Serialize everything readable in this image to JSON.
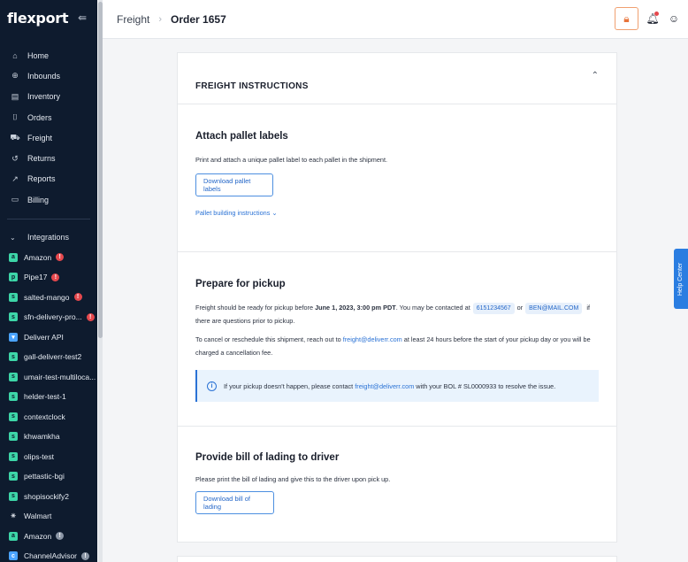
{
  "sidebar": {
    "logo": "flexport",
    "nav": [
      {
        "label": "Home",
        "icon": "home-icon",
        "glyph": "⌂"
      },
      {
        "label": "Inbounds",
        "icon": "inbounds-icon",
        "glyph": "⊕"
      },
      {
        "label": "Inventory",
        "icon": "inventory-icon",
        "glyph": "▤"
      },
      {
        "label": "Orders",
        "icon": "orders-icon",
        "glyph": "⌷"
      },
      {
        "label": "Freight",
        "icon": "freight-icon",
        "glyph": "⛟"
      },
      {
        "label": "Returns",
        "icon": "returns-icon",
        "glyph": "↺"
      },
      {
        "label": "Reports",
        "icon": "reports-icon",
        "glyph": "↗"
      },
      {
        "label": "Billing",
        "icon": "billing-icon",
        "glyph": "▭"
      }
    ],
    "integrations_label": "Integrations",
    "integrations": [
      {
        "label": "Amazon",
        "store": "amazon",
        "color": "#3dd6a8",
        "glyph": "a",
        "badge": "!",
        "badge_type": "red"
      },
      {
        "label": "Pipe17",
        "store": "pipe17",
        "color": "#3dd6a8",
        "glyph": "p",
        "badge": "!",
        "badge_type": "red"
      },
      {
        "label": "salted-mango",
        "store": "shopify",
        "color": "#3dd6a8",
        "glyph": "s",
        "badge": "!",
        "badge_type": "red"
      },
      {
        "label": "sfn-delivery-pro...",
        "store": "shopify",
        "color": "#3dd6a8",
        "glyph": "s",
        "badge": "!",
        "badge_type": "red"
      },
      {
        "label": "Deliverr API",
        "store": "deliverr",
        "color": "#4aa3ff",
        "glyph": "▾",
        "badge": "",
        "badge_type": ""
      },
      {
        "label": "gall-deliverr-test2",
        "store": "shopify",
        "color": "#3dd6a8",
        "glyph": "s",
        "badge": "",
        "badge_type": ""
      },
      {
        "label": "umair-test-multiloca...",
        "store": "shopify",
        "color": "#3dd6a8",
        "glyph": "s",
        "badge": "",
        "badge_type": ""
      },
      {
        "label": "helder-test-1",
        "store": "shopify",
        "color": "#3dd6a8",
        "glyph": "s",
        "badge": "",
        "badge_type": ""
      },
      {
        "label": "contextclock",
        "store": "shopify",
        "color": "#3dd6a8",
        "glyph": "s",
        "badge": "",
        "badge_type": ""
      },
      {
        "label": "khwamkha",
        "store": "shopify",
        "color": "#3dd6a8",
        "glyph": "s",
        "badge": "",
        "badge_type": ""
      },
      {
        "label": "olips-test",
        "store": "shopify",
        "color": "#3dd6a8",
        "glyph": "s",
        "badge": "",
        "badge_type": ""
      },
      {
        "label": "pettastic-bgi",
        "store": "shopify",
        "color": "#3dd6a8",
        "glyph": "s",
        "badge": "",
        "badge_type": ""
      },
      {
        "label": "shopisockify2",
        "store": "shopify",
        "color": "#3dd6a8",
        "glyph": "s",
        "badge": "",
        "badge_type": ""
      },
      {
        "label": "Walmart",
        "store": "walmart",
        "color": "#0e1b2e",
        "glyph": "✳",
        "badge": "",
        "badge_type": ""
      },
      {
        "label": "Amazon",
        "store": "amazon",
        "color": "#3dd6a8",
        "glyph": "a",
        "badge": "!",
        "badge_type": "grey"
      },
      {
        "label": "ChannelAdvisor",
        "store": "channeladvisor",
        "color": "#4aa3ff",
        "glyph": "c",
        "badge": "!",
        "badge_type": "grey"
      }
    ]
  },
  "header": {
    "breadcrumb_parent": "Freight",
    "breadcrumb_current": "Order 1657"
  },
  "card": {
    "title": "FREIGHT INSTRUCTIONS",
    "attach": {
      "heading": "Attach pallet labels",
      "text": "Print and attach a unique pallet label to each pallet in the shipment.",
      "button": "Download pallet labels",
      "link": "Pallet building instructions"
    },
    "pickup": {
      "heading": "Prepare for pickup",
      "text_a": "Freight should be ready for pickup before ",
      "date": "June 1, 2023, 3:00 pm PDT",
      "text_b": ". You may be contacted at",
      "phone": "6151234567",
      "or": "or",
      "email": "BEN@MAIL.COM",
      "text_c": "if there are questions prior to pickup.",
      "cancel_a": "To cancel or reschedule this shipment, reach out to ",
      "cancel_email": "freight@deliverr.com",
      "cancel_b": " at least 24 hours before the start of your pickup day or you will be charged a cancellation fee.",
      "info_a": "If your pickup doesn't happen, please contact ",
      "info_email": "freight@deliverr.com",
      "info_b": " with your BOL # SL0000933 to resolve the issue."
    },
    "bol": {
      "heading": "Provide bill of lading to driver",
      "text": "Please print the bill of lading and give this to the driver upon pick up.",
      "button": "Download bill of lading"
    }
  },
  "help_center": "Help Center"
}
